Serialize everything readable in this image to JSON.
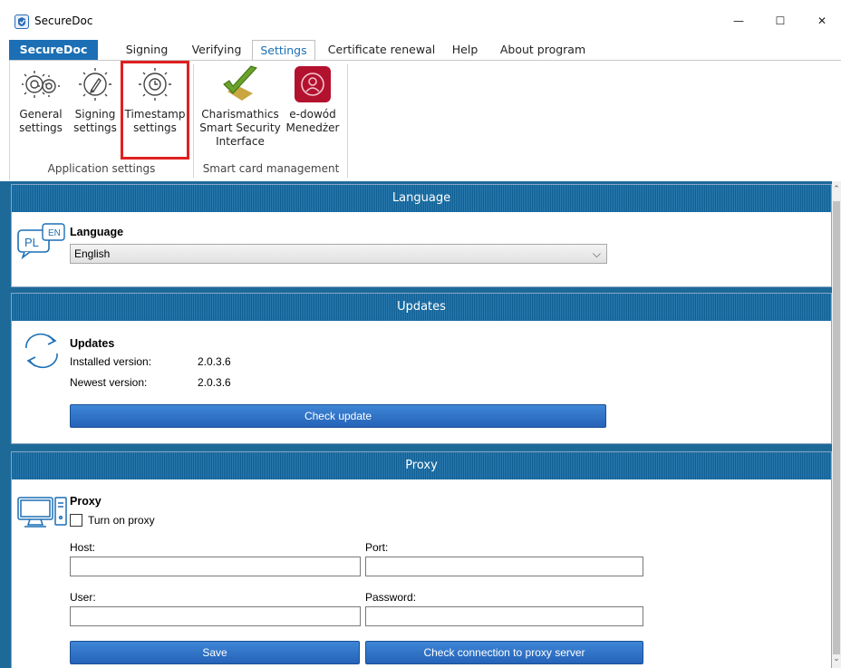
{
  "window": {
    "title": "SecureDoc",
    "controls": {
      "minimize": "—",
      "maximize": "☐",
      "close": "✕"
    }
  },
  "tabs": [
    {
      "label": "SecureDoc",
      "type": "file"
    },
    {
      "label": "Signing"
    },
    {
      "label": "Verifying"
    },
    {
      "label": "Settings",
      "active": true
    },
    {
      "label": "Certificate renewal"
    },
    {
      "label": "Help"
    },
    {
      "label": "About program"
    }
  ],
  "ribbon": {
    "application_settings": {
      "group_label": "Application settings",
      "buttons": [
        {
          "line1": "General",
          "line2": "settings",
          "icon": "gear-icon"
        },
        {
          "line1": "Signing",
          "line2": "settings",
          "icon": "gear-pen-icon"
        },
        {
          "line1": "Timestamp",
          "line2": "settings",
          "icon": "gear-clock-icon"
        }
      ]
    },
    "smart_card": {
      "group_label": "Smart card management",
      "buttons": [
        {
          "line1": "Charismathics",
          "line2": "Smart Security",
          "line3": "Interface",
          "icon": "checkmark-card-icon"
        },
        {
          "line1": "e-dowód",
          "line2": "Menedżer",
          "icon": "edowod-icon"
        }
      ]
    }
  },
  "language": {
    "header": "Language",
    "title": "Language",
    "selected": "English",
    "icon_text_a": "PL",
    "icon_text_b": "EN"
  },
  "updates": {
    "header": "Updates",
    "title": "Updates",
    "installed_label": "Installed version:",
    "installed_value": "2.0.3.6",
    "newest_label": "Newest version:",
    "newest_value": "2.0.3.6",
    "check_button": "Check update"
  },
  "proxy": {
    "header": "Proxy",
    "title": "Proxy",
    "turn_on_label": "Turn on proxy",
    "host_label": "Host:",
    "port_label": "Port:",
    "user_label": "User:",
    "password_label": "Password:",
    "save_button": "Save",
    "check_button": "Check connection to proxy server"
  },
  "colors": {
    "accent": "#1c6fb5",
    "header_bar": "#1d6a99",
    "highlight": "#e02020",
    "button": "#2d6fc4"
  }
}
